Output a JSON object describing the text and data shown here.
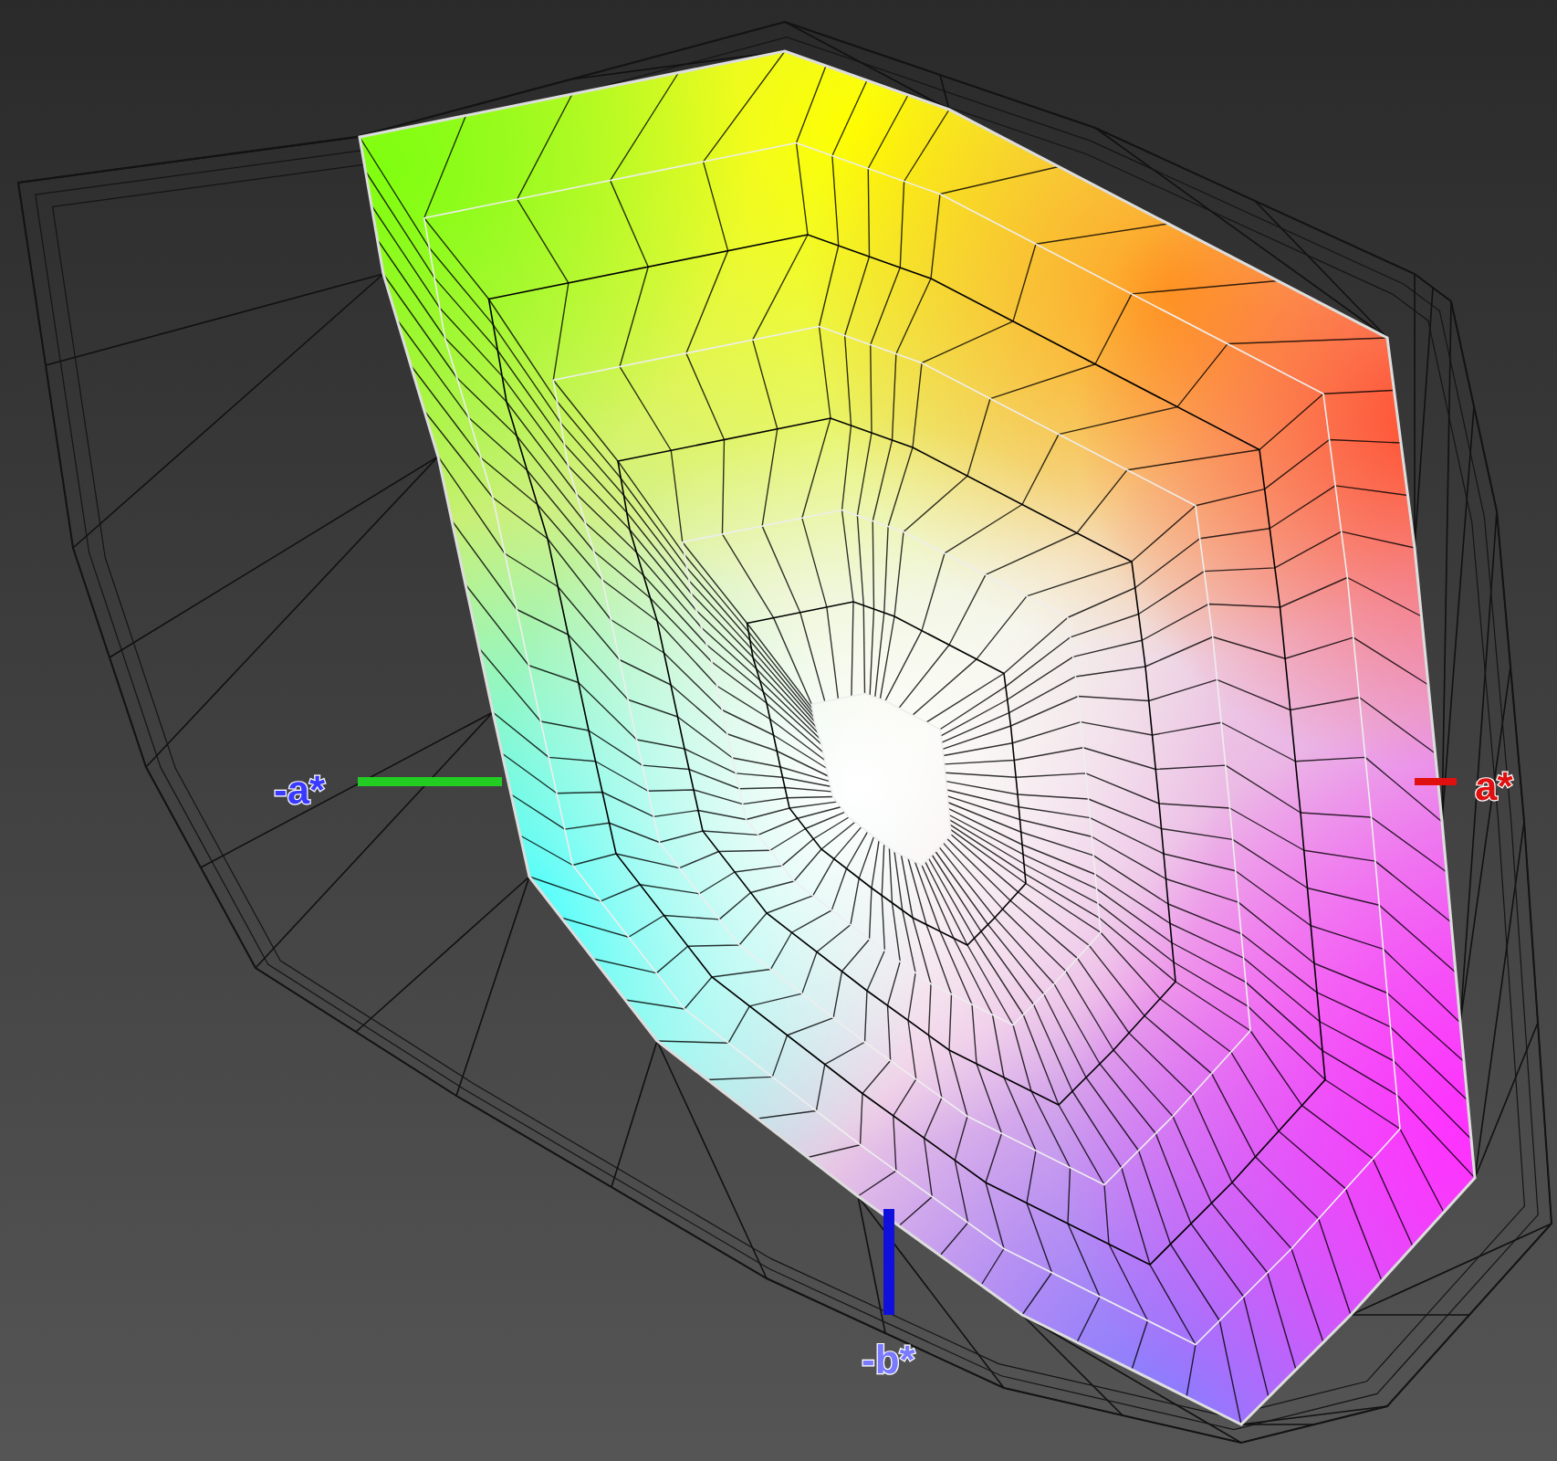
{
  "axis_lines": [
    {
      "color": "#22cc22"
    },
    {
      "color": "#e01010"
    },
    {
      "color": "#1010dd"
    }
  ],
  "axis_labels": [
    {
      "label": "-a*",
      "color": "#3a3aff"
    },
    {
      "label": "a*",
      "color": "#e01010"
    },
    {
      "label": "-b*",
      "color": "#7a7aff"
    }
  ]
}
